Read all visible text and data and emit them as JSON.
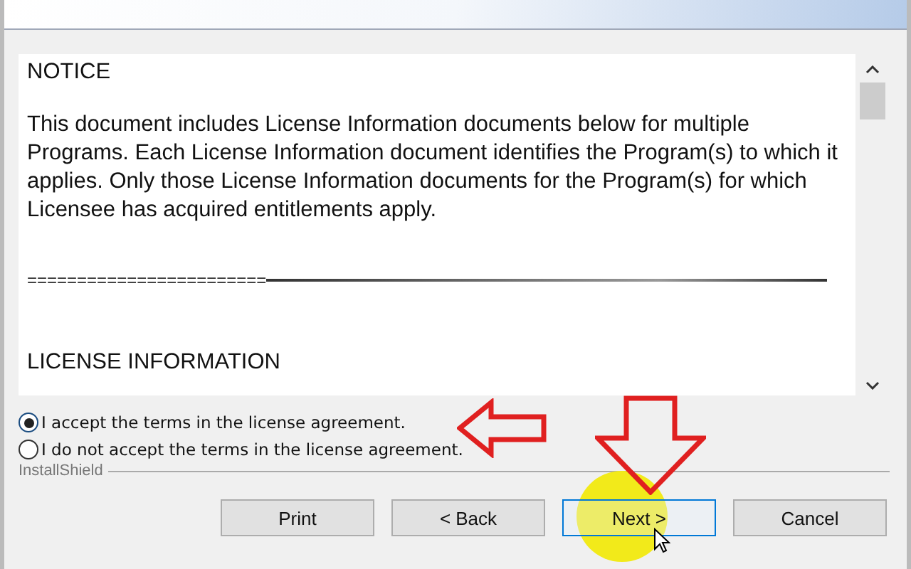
{
  "license": {
    "heading": "NOTICE",
    "paragraph": "This document includes License Information documents below for multiple Programs. Each License Information document identifies the Program(s) to which it applies. Only those License Information documents for the Program(s) for which Licensee has acquired entitlements apply.",
    "separator": "========================",
    "section": "LICENSE INFORMATION"
  },
  "options": [
    {
      "label": "I accept the terms in the license agreement.",
      "selected": true
    },
    {
      "label": "I do not accept the terms in the license agreement.",
      "selected": false
    }
  ],
  "brand": "InstallShield",
  "buttons": [
    {
      "label": "Print",
      "selected": false
    },
    {
      "label": "< Back",
      "selected": false
    },
    {
      "label": "Next >",
      "selected": true
    },
    {
      "label": "Cancel",
      "selected": false
    }
  ]
}
